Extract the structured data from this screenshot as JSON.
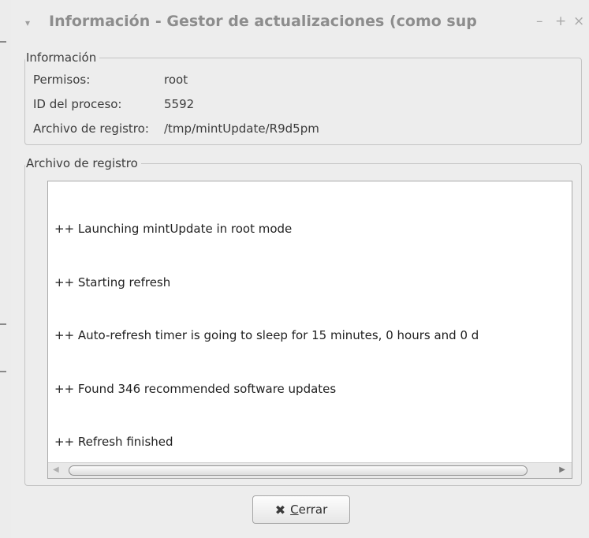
{
  "window": {
    "title": "Información - Gestor de actualizaciones (como sup",
    "menu_glyph": "▾",
    "minimize_glyph": "–",
    "maximize_glyph": "+",
    "close_glyph": "×"
  },
  "info_frame": {
    "legend": "Información",
    "rows": [
      {
        "label": "Permisos:",
        "value": "root"
      },
      {
        "label": "ID del proceso:",
        "value": "5592"
      },
      {
        "label": "Archivo de registro:",
        "value": "/tmp/mintUpdate/R9d5pm"
      }
    ]
  },
  "log_frame": {
    "legend": "Archivo de registro",
    "lines": [
      "++ Launching mintUpdate in root mode",
      "++ Starting refresh",
      "++ Auto-refresh timer is going to sleep for 15 minutes, 0 hours and 0 d",
      "++ Found 346 recommended software updates",
      "++ Refresh finished"
    ],
    "scroll_left_glyph": "◀",
    "scroll_right_glyph": "▶"
  },
  "close_button": {
    "icon_glyph": "✖",
    "mnemonic": "C",
    "label_rest": "errar"
  }
}
